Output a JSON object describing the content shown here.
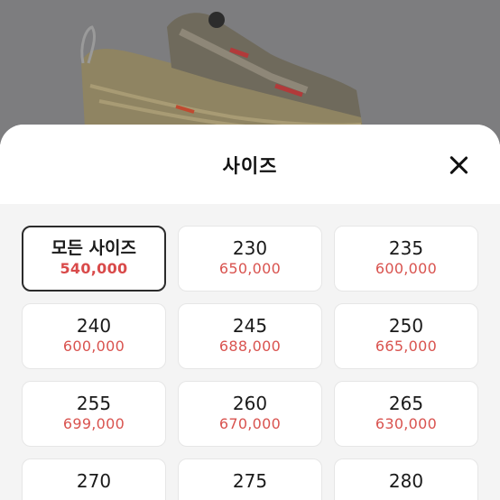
{
  "sheet": {
    "title": "사이즈",
    "close_icon": "close-icon"
  },
  "colors": {
    "price": "#d9534f",
    "selected_border": "#2b2b2b",
    "backdrop": "#7d7d7f"
  },
  "sizes": [
    {
      "label": "모든 사이즈",
      "price": "540,000",
      "selected": true
    },
    {
      "label": "230",
      "price": "650,000",
      "selected": false
    },
    {
      "label": "235",
      "price": "600,000",
      "selected": false
    },
    {
      "label": "240",
      "price": "600,000",
      "selected": false
    },
    {
      "label": "245",
      "price": "688,000",
      "selected": false
    },
    {
      "label": "250",
      "price": "665,000",
      "selected": false
    },
    {
      "label": "255",
      "price": "699,000",
      "selected": false
    },
    {
      "label": "260",
      "price": "670,000",
      "selected": false
    },
    {
      "label": "265",
      "price": "630,000",
      "selected": false
    },
    {
      "label": "270",
      "price": "",
      "selected": false
    },
    {
      "label": "275",
      "price": "",
      "selected": false
    },
    {
      "label": "280",
      "price": "",
      "selected": false
    }
  ]
}
